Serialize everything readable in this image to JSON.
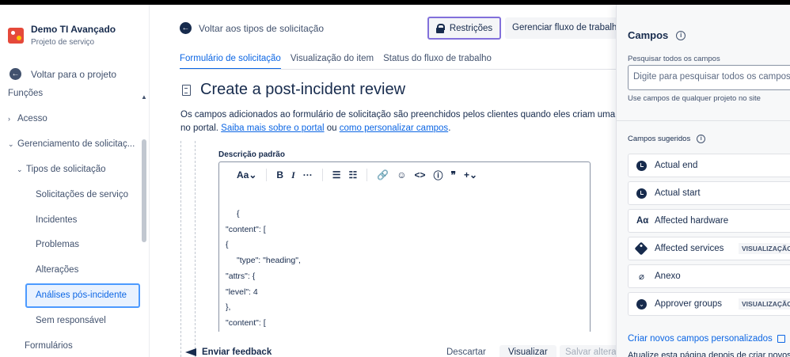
{
  "project": {
    "name": "Demo TI Avançado",
    "type": "Projeto de serviço"
  },
  "sidebar": {
    "back_label": "Voltar para o projeto",
    "items": [
      {
        "label": "Funções",
        "chevron": ""
      },
      {
        "label": "Acesso",
        "chevron": "›"
      },
      {
        "label": "Gerenciamento de solicitaç...",
        "chevron": "⌄"
      },
      {
        "label": "Tipos de solicitação",
        "chevron": "⌄"
      },
      {
        "label": "Solicitações de serviço",
        "chevron": ""
      },
      {
        "label": "Incidentes",
        "chevron": ""
      },
      {
        "label": "Problemas",
        "chevron": ""
      },
      {
        "label": "Alterações",
        "chevron": ""
      },
      {
        "label": "Análises pós-incidente",
        "chevron": ""
      },
      {
        "label": "Sem responsável",
        "chevron": ""
      },
      {
        "label": "Formulários",
        "chevron": ""
      }
    ]
  },
  "header": {
    "back_label": "Voltar aos tipos de solicitação",
    "restrictions_label": "Restrições",
    "workflow_label": "Gerenciar fluxo de trabalho"
  },
  "tabs": [
    {
      "label": "Formulário de solicitação",
      "active": true
    },
    {
      "label": "Visualização do item",
      "active": false
    },
    {
      "label": "Status do fluxo de trabalho",
      "active": false
    }
  ],
  "page": {
    "title": "Create a post-incident review",
    "desc_text": "Os campos adicionados ao formulário de solicitação são preenchidos pelos clientes quando eles criam uma solicitação",
    "desc_text2": "no portal.",
    "link_portal": "Saiba mais sobre o portal",
    "desc_or": "ou",
    "link_fields": "como personalizar campos",
    "desc_end": "."
  },
  "editor": {
    "field_label": "Descrição padrão",
    "toolbar": [
      "Aa⌄",
      "B",
      "I",
      "···",
      "☰",
      "☷",
      "🔗",
      "☺",
      "<>",
      "ⓘ",
      "❞",
      "+⌄"
    ],
    "code_lines": [
      "{",
      "\"content\": [",
      "{",
      "\"type\": \"heading\",",
      "\"attrs\": {",
      "\"level\": 4",
      "},",
      "\"content\": ["
    ]
  },
  "footer": {
    "feedback_label": "Enviar feedback",
    "discard_label": "Descartar",
    "preview_label": "Visualizar",
    "save_label": "Salvar alterações"
  },
  "fields_panel": {
    "title": "Campos",
    "search_label": "Pesquisar todos os campos",
    "search_placeholder": "Digite para pesquisar todos os campos",
    "search_hint": "Use campos de qualquer projeto no site",
    "suggested_label": "Campos sugeridos",
    "fields": [
      {
        "label": "Actual end",
        "icon": "clock-icon",
        "badge": ""
      },
      {
        "label": "Actual start",
        "icon": "clock-icon",
        "badge": ""
      },
      {
        "label": "Affected hardware",
        "icon": "text-icon",
        "badge": ""
      },
      {
        "label": "Affected services",
        "icon": "tag-icon",
        "badge": "VISUALIZAÇÃO D"
      },
      {
        "label": "Anexo",
        "icon": "paperclip-icon",
        "badge": ""
      },
      {
        "label": "Approver groups",
        "icon": "select-icon",
        "badge": "VISUALIZAÇÃO D"
      }
    ],
    "create_link": "Criar novos campos personalizados",
    "last_line": "Atualize esta página depois de criar novos"
  }
}
